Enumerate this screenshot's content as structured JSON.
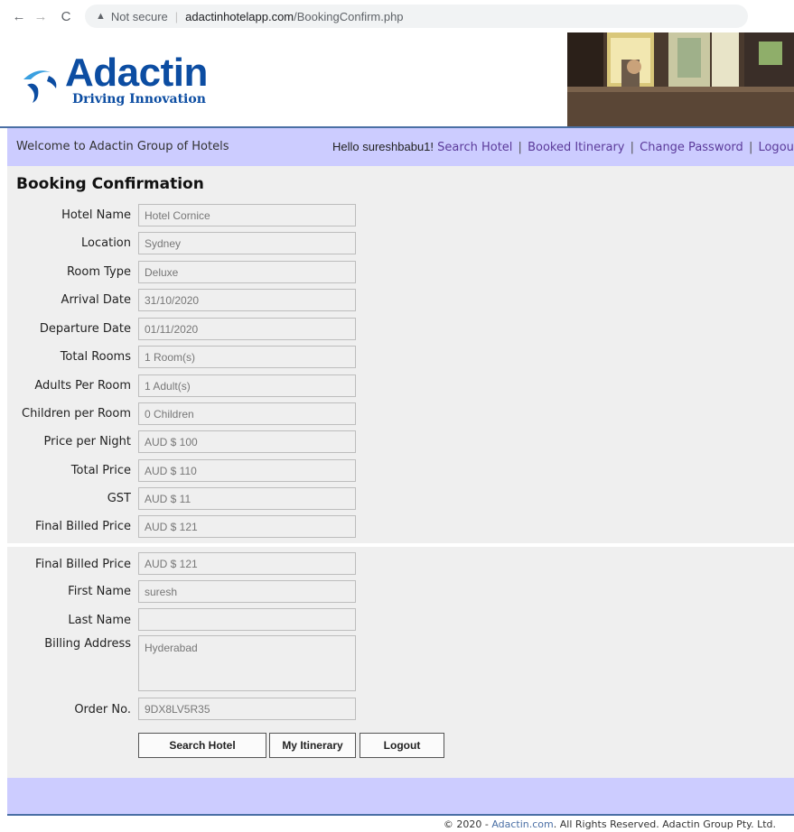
{
  "browser": {
    "security_label": "Not secure",
    "url_domain": "adactinhotelapp.com",
    "url_path": "/BookingConfirm.php"
  },
  "header": {
    "brand_name": "Adactin",
    "brand_tagline": "Driving Innovation",
    "brand_color": "#0c4da2"
  },
  "welcome_bar": {
    "welcome_text": "Welcome to Adactin Group of Hotels",
    "hello_text": "Hello sureshbabu1!",
    "links": [
      "Search Hotel",
      "Booked Itinerary",
      "Change Password",
      "Logout"
    ],
    "link_color": "#5b3a9a",
    "bar_color": "#ccccff"
  },
  "booking": {
    "title": "Booking Confirmation",
    "fields": [
      {
        "label": "Hotel Name",
        "value": "Hotel Cornice"
      },
      {
        "label": "Location",
        "value": "Sydney"
      },
      {
        "label": "Room Type",
        "value": "Deluxe"
      },
      {
        "label": "Arrival Date",
        "value": "31/10/2020"
      },
      {
        "label": "Departure Date",
        "value": "01/11/2020"
      },
      {
        "label": "Total Rooms",
        "value": "1 Room(s)"
      },
      {
        "label": "Adults Per Room",
        "value": "1 Adult(s)"
      },
      {
        "label": "Children per Room",
        "value": "0 Children"
      },
      {
        "label": "Price per Night",
        "value": "AUD $ 100"
      },
      {
        "label": "Total Price",
        "value": "AUD $ 110"
      },
      {
        "label": "GST",
        "value": "AUD $ 11"
      },
      {
        "label": "Final Billed Price",
        "value": "AUD $ 121"
      }
    ]
  },
  "billing": {
    "fields": [
      {
        "label": "Final Billed Price",
        "value": "AUD $ 121"
      },
      {
        "label": "First Name",
        "value": "suresh"
      },
      {
        "label": "Last Name",
        "value": ""
      },
      {
        "label": "Billing Address",
        "value": "Hyderabad"
      },
      {
        "label": "Order No.",
        "value": "9DX8LV5R35"
      }
    ]
  },
  "buttons": {
    "search_hotel": "Search Hotel",
    "my_itinerary": "My Itinerary",
    "logout": "Logout"
  },
  "footer": {
    "copyright_prefix": "© 2020 - ",
    "copyright_link": "Adactin.com",
    "copyright_suffix": ". All Rights Reserved. Adactin Group Pty. Ltd."
  }
}
